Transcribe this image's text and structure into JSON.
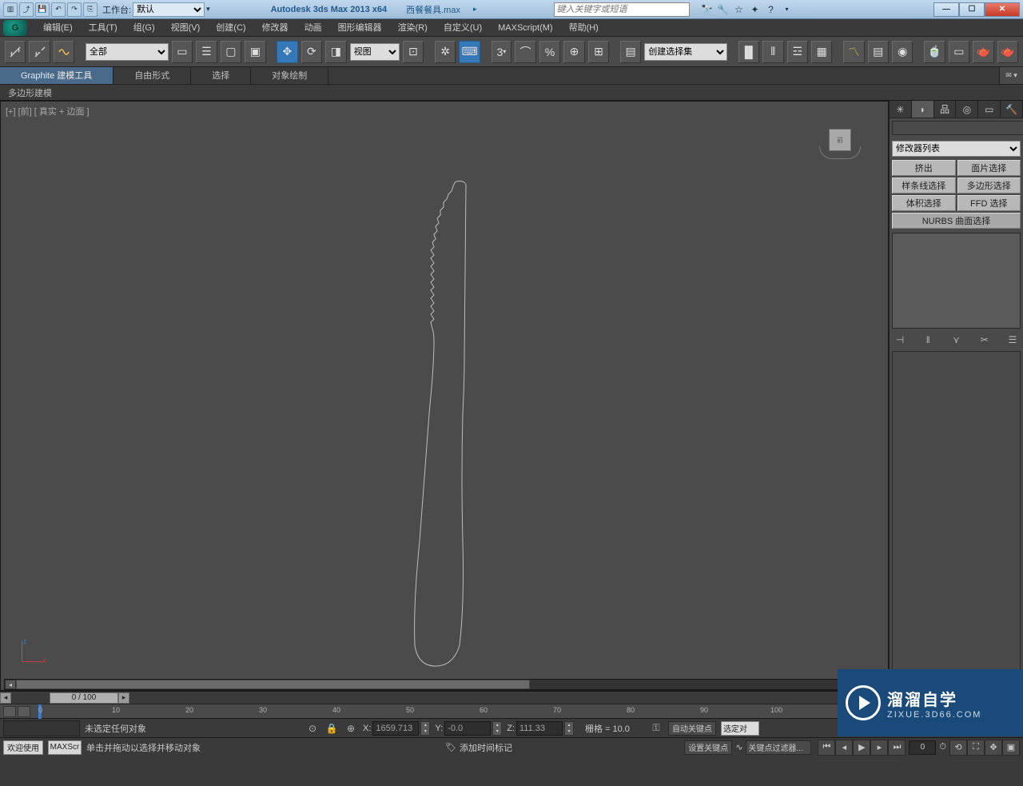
{
  "titlebar": {
    "workspace_label": "工作台:",
    "workspace_value": "默认",
    "app_title": "Autodesk 3ds Max  2013 x64",
    "file_name": "西餐餐具.max",
    "search_placeholder": "键入关键字或短语"
  },
  "menus": [
    "编辑(E)",
    "工具(T)",
    "组(G)",
    "视图(V)",
    "创建(C)",
    "修改器",
    "动画",
    "图形编辑器",
    "渲染(R)",
    "自定义(U)",
    "MAXScript(M)",
    "帮助(H)"
  ],
  "toolbar": {
    "filter_all": "全部",
    "view_dd": "视图",
    "selset_placeholder": "创建选择集"
  },
  "ribbon": {
    "tabs": [
      "Graphite 建模工具",
      "自由形式",
      "选择",
      "对象绘制"
    ],
    "sub": "多边形建模"
  },
  "viewport": {
    "label_prefix": "[+]",
    "label_view": "[前]",
    "label_mode": "[ 真实 + 边面 ]",
    "cube_face": "前"
  },
  "cmdpanel": {
    "modlist_label": "修改器列表",
    "buttons": [
      "挤出",
      "面片选择",
      "样条线选择",
      "多边形选择",
      "体积选择",
      "FFD 选择"
    ],
    "nurbs": "NURBS 曲面选择"
  },
  "timeline": {
    "thumb": "0 / 100",
    "ticks": [
      "0",
      "10",
      "20",
      "30",
      "40",
      "50",
      "60",
      "70",
      "80",
      "90",
      "100"
    ]
  },
  "statusA": {
    "msg": "未选定任何对象",
    "x": "1659.713",
    "y": "-0.0",
    "z": "111.33",
    "grid": "栅格 = 10.0",
    "autokey": "自动关键点",
    "selset": "选定对"
  },
  "statusB": {
    "welcome": "欢迎使用",
    "mx": "MAXScr",
    "hint": "单击并拖动以选择并移动对象",
    "addtag": "添加时间标记",
    "setkey": "设置关键点",
    "filter": "关键点过滤器...",
    "frame": "0"
  },
  "watermark": {
    "big": "溜溜自学",
    "sub": "ZIXUE.3D66.COM"
  }
}
